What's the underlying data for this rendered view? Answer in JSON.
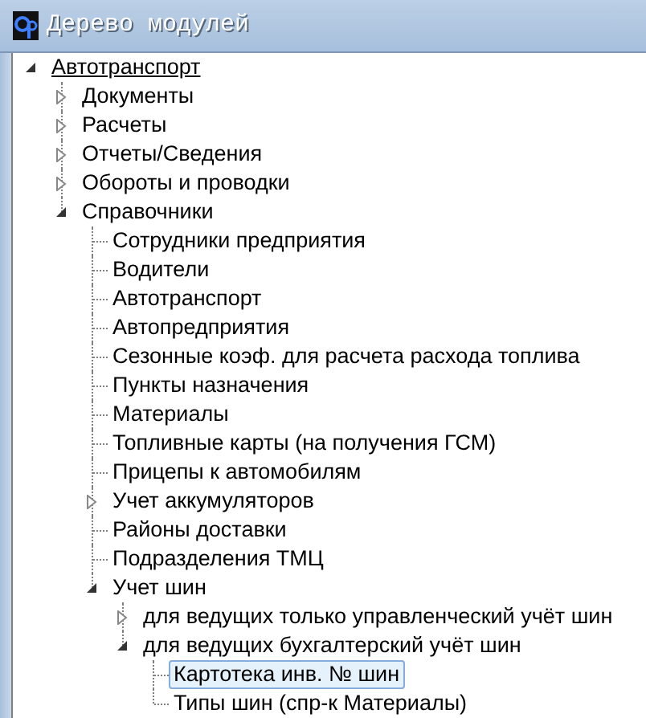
{
  "window": {
    "title": "Дерево модулей"
  },
  "tree": [
    {
      "label": "Автотранспорт",
      "expanded": true,
      "selected": false,
      "hot": true,
      "children": [
        {
          "label": "Документы",
          "expanded": false,
          "selected": false,
          "hot": false
        },
        {
          "label": "Расчеты",
          "expanded": false,
          "selected": false,
          "hot": false
        },
        {
          "label": "Отчеты/Сведения",
          "expanded": false,
          "selected": false,
          "hot": false
        },
        {
          "label": "Обороты и проводки",
          "expanded": false,
          "selected": false,
          "hot": false
        },
        {
          "label": "Справочники",
          "expanded": true,
          "selected": false,
          "hot": false,
          "children": [
            {
              "label": "Сотрудники предприятия",
              "selected": false,
              "hot": false
            },
            {
              "label": "Водители",
              "selected": false,
              "hot": false
            },
            {
              "label": "Автотранспорт",
              "selected": false,
              "hot": false
            },
            {
              "label": "Автопредприятия",
              "selected": false,
              "hot": false
            },
            {
              "label": "Сезонные коэф. для расчета расхода топлива",
              "selected": false,
              "hot": false
            },
            {
              "label": "Пункты назначения",
              "selected": false,
              "hot": false
            },
            {
              "label": "Материалы",
              "selected": false,
              "hot": false
            },
            {
              "label": "Топливные карты (на получения ГСМ)",
              "selected": false,
              "hot": false
            },
            {
              "label": "Прицепы к автомобилям",
              "selected": false,
              "hot": false
            },
            {
              "label": "Учет аккумуляторов",
              "expanded": false,
              "selected": false,
              "hot": false
            },
            {
              "label": "Районы доставки",
              "selected": false,
              "hot": false
            },
            {
              "label": "Подразделения ТМЦ",
              "selected": false,
              "hot": false
            },
            {
              "label": "Учет шин",
              "expanded": true,
              "selected": false,
              "hot": false,
              "children": [
                {
                  "label": "для ведущих только управленческий учёт шин",
                  "expanded": false,
                  "selected": false,
                  "hot": false
                },
                {
                  "label": "для ведущих бухгалтерский учёт шин",
                  "expanded": true,
                  "selected": false,
                  "hot": false,
                  "children": [
                    {
                      "label": "Картотека инв. № шин",
                      "selected": true,
                      "hot": false
                    },
                    {
                      "label": "Типы шин (спр-к Материалы)",
                      "selected": false,
                      "hot": false
                    }
                  ]
                }
              ]
            }
          ]
        }
      ]
    }
  ]
}
